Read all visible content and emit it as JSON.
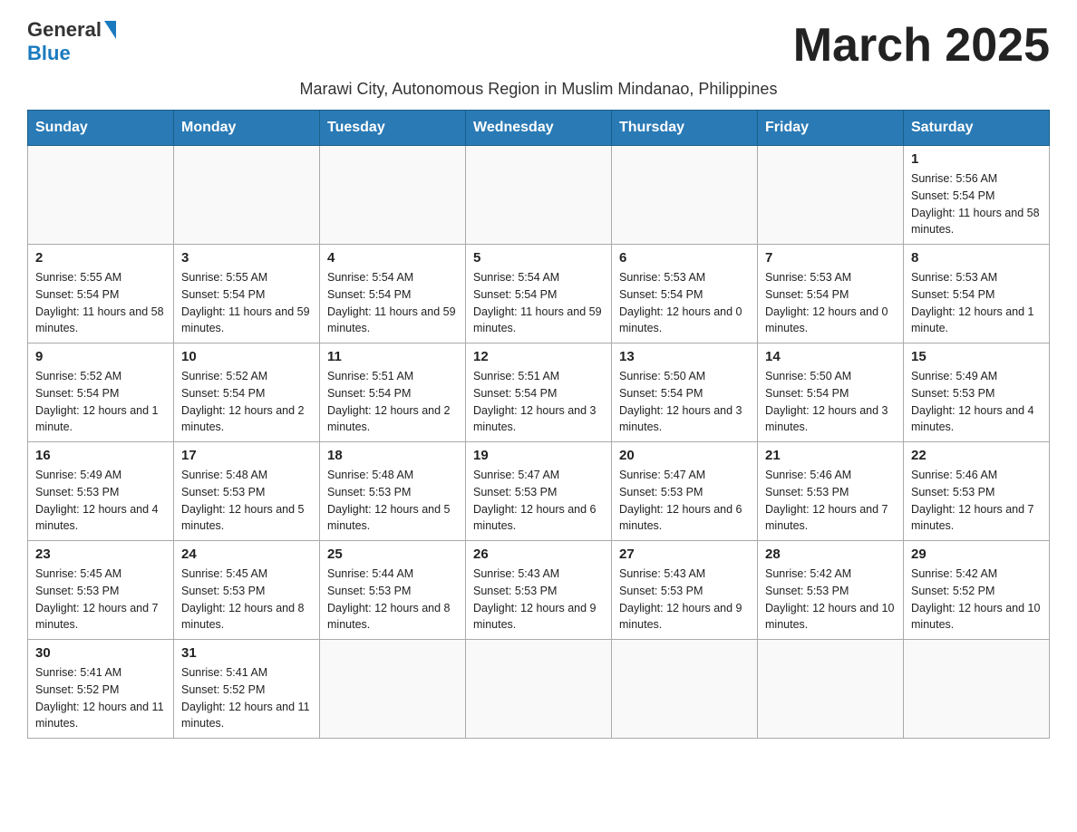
{
  "header": {
    "logo_general": "General",
    "logo_blue": "Blue",
    "month_title": "March 2025",
    "subtitle": "Marawi City, Autonomous Region in Muslim Mindanao, Philippines"
  },
  "weekdays": [
    "Sunday",
    "Monday",
    "Tuesday",
    "Wednesday",
    "Thursday",
    "Friday",
    "Saturday"
  ],
  "weeks": [
    [
      {
        "day": "",
        "sunrise": "",
        "sunset": "",
        "daylight": ""
      },
      {
        "day": "",
        "sunrise": "",
        "sunset": "",
        "daylight": ""
      },
      {
        "day": "",
        "sunrise": "",
        "sunset": "",
        "daylight": ""
      },
      {
        "day": "",
        "sunrise": "",
        "sunset": "",
        "daylight": ""
      },
      {
        "day": "",
        "sunrise": "",
        "sunset": "",
        "daylight": ""
      },
      {
        "day": "",
        "sunrise": "",
        "sunset": "",
        "daylight": ""
      },
      {
        "day": "1",
        "sunrise": "Sunrise: 5:56 AM",
        "sunset": "Sunset: 5:54 PM",
        "daylight": "Daylight: 11 hours and 58 minutes."
      }
    ],
    [
      {
        "day": "2",
        "sunrise": "Sunrise: 5:55 AM",
        "sunset": "Sunset: 5:54 PM",
        "daylight": "Daylight: 11 hours and 58 minutes."
      },
      {
        "day": "3",
        "sunrise": "Sunrise: 5:55 AM",
        "sunset": "Sunset: 5:54 PM",
        "daylight": "Daylight: 11 hours and 59 minutes."
      },
      {
        "day": "4",
        "sunrise": "Sunrise: 5:54 AM",
        "sunset": "Sunset: 5:54 PM",
        "daylight": "Daylight: 11 hours and 59 minutes."
      },
      {
        "day": "5",
        "sunrise": "Sunrise: 5:54 AM",
        "sunset": "Sunset: 5:54 PM",
        "daylight": "Daylight: 11 hours and 59 minutes."
      },
      {
        "day": "6",
        "sunrise": "Sunrise: 5:53 AM",
        "sunset": "Sunset: 5:54 PM",
        "daylight": "Daylight: 12 hours and 0 minutes."
      },
      {
        "day": "7",
        "sunrise": "Sunrise: 5:53 AM",
        "sunset": "Sunset: 5:54 PM",
        "daylight": "Daylight: 12 hours and 0 minutes."
      },
      {
        "day": "8",
        "sunrise": "Sunrise: 5:53 AM",
        "sunset": "Sunset: 5:54 PM",
        "daylight": "Daylight: 12 hours and 1 minute."
      }
    ],
    [
      {
        "day": "9",
        "sunrise": "Sunrise: 5:52 AM",
        "sunset": "Sunset: 5:54 PM",
        "daylight": "Daylight: 12 hours and 1 minute."
      },
      {
        "day": "10",
        "sunrise": "Sunrise: 5:52 AM",
        "sunset": "Sunset: 5:54 PM",
        "daylight": "Daylight: 12 hours and 2 minutes."
      },
      {
        "day": "11",
        "sunrise": "Sunrise: 5:51 AM",
        "sunset": "Sunset: 5:54 PM",
        "daylight": "Daylight: 12 hours and 2 minutes."
      },
      {
        "day": "12",
        "sunrise": "Sunrise: 5:51 AM",
        "sunset": "Sunset: 5:54 PM",
        "daylight": "Daylight: 12 hours and 3 minutes."
      },
      {
        "day": "13",
        "sunrise": "Sunrise: 5:50 AM",
        "sunset": "Sunset: 5:54 PM",
        "daylight": "Daylight: 12 hours and 3 minutes."
      },
      {
        "day": "14",
        "sunrise": "Sunrise: 5:50 AM",
        "sunset": "Sunset: 5:54 PM",
        "daylight": "Daylight: 12 hours and 3 minutes."
      },
      {
        "day": "15",
        "sunrise": "Sunrise: 5:49 AM",
        "sunset": "Sunset: 5:53 PM",
        "daylight": "Daylight: 12 hours and 4 minutes."
      }
    ],
    [
      {
        "day": "16",
        "sunrise": "Sunrise: 5:49 AM",
        "sunset": "Sunset: 5:53 PM",
        "daylight": "Daylight: 12 hours and 4 minutes."
      },
      {
        "day": "17",
        "sunrise": "Sunrise: 5:48 AM",
        "sunset": "Sunset: 5:53 PM",
        "daylight": "Daylight: 12 hours and 5 minutes."
      },
      {
        "day": "18",
        "sunrise": "Sunrise: 5:48 AM",
        "sunset": "Sunset: 5:53 PM",
        "daylight": "Daylight: 12 hours and 5 minutes."
      },
      {
        "day": "19",
        "sunrise": "Sunrise: 5:47 AM",
        "sunset": "Sunset: 5:53 PM",
        "daylight": "Daylight: 12 hours and 6 minutes."
      },
      {
        "day": "20",
        "sunrise": "Sunrise: 5:47 AM",
        "sunset": "Sunset: 5:53 PM",
        "daylight": "Daylight: 12 hours and 6 minutes."
      },
      {
        "day": "21",
        "sunrise": "Sunrise: 5:46 AM",
        "sunset": "Sunset: 5:53 PM",
        "daylight": "Daylight: 12 hours and 7 minutes."
      },
      {
        "day": "22",
        "sunrise": "Sunrise: 5:46 AM",
        "sunset": "Sunset: 5:53 PM",
        "daylight": "Daylight: 12 hours and 7 minutes."
      }
    ],
    [
      {
        "day": "23",
        "sunrise": "Sunrise: 5:45 AM",
        "sunset": "Sunset: 5:53 PM",
        "daylight": "Daylight: 12 hours and 7 minutes."
      },
      {
        "day": "24",
        "sunrise": "Sunrise: 5:45 AM",
        "sunset": "Sunset: 5:53 PM",
        "daylight": "Daylight: 12 hours and 8 minutes."
      },
      {
        "day": "25",
        "sunrise": "Sunrise: 5:44 AM",
        "sunset": "Sunset: 5:53 PM",
        "daylight": "Daylight: 12 hours and 8 minutes."
      },
      {
        "day": "26",
        "sunrise": "Sunrise: 5:43 AM",
        "sunset": "Sunset: 5:53 PM",
        "daylight": "Daylight: 12 hours and 9 minutes."
      },
      {
        "day": "27",
        "sunrise": "Sunrise: 5:43 AM",
        "sunset": "Sunset: 5:53 PM",
        "daylight": "Daylight: 12 hours and 9 minutes."
      },
      {
        "day": "28",
        "sunrise": "Sunrise: 5:42 AM",
        "sunset": "Sunset: 5:53 PM",
        "daylight": "Daylight: 12 hours and 10 minutes."
      },
      {
        "day": "29",
        "sunrise": "Sunrise: 5:42 AM",
        "sunset": "Sunset: 5:52 PM",
        "daylight": "Daylight: 12 hours and 10 minutes."
      }
    ],
    [
      {
        "day": "30",
        "sunrise": "Sunrise: 5:41 AM",
        "sunset": "Sunset: 5:52 PM",
        "daylight": "Daylight: 12 hours and 11 minutes."
      },
      {
        "day": "31",
        "sunrise": "Sunrise: 5:41 AM",
        "sunset": "Sunset: 5:52 PM",
        "daylight": "Daylight: 12 hours and 11 minutes."
      },
      {
        "day": "",
        "sunrise": "",
        "sunset": "",
        "daylight": ""
      },
      {
        "day": "",
        "sunrise": "",
        "sunset": "",
        "daylight": ""
      },
      {
        "day": "",
        "sunrise": "",
        "sunset": "",
        "daylight": ""
      },
      {
        "day": "",
        "sunrise": "",
        "sunset": "",
        "daylight": ""
      },
      {
        "day": "",
        "sunrise": "",
        "sunset": "",
        "daylight": ""
      }
    ]
  ]
}
